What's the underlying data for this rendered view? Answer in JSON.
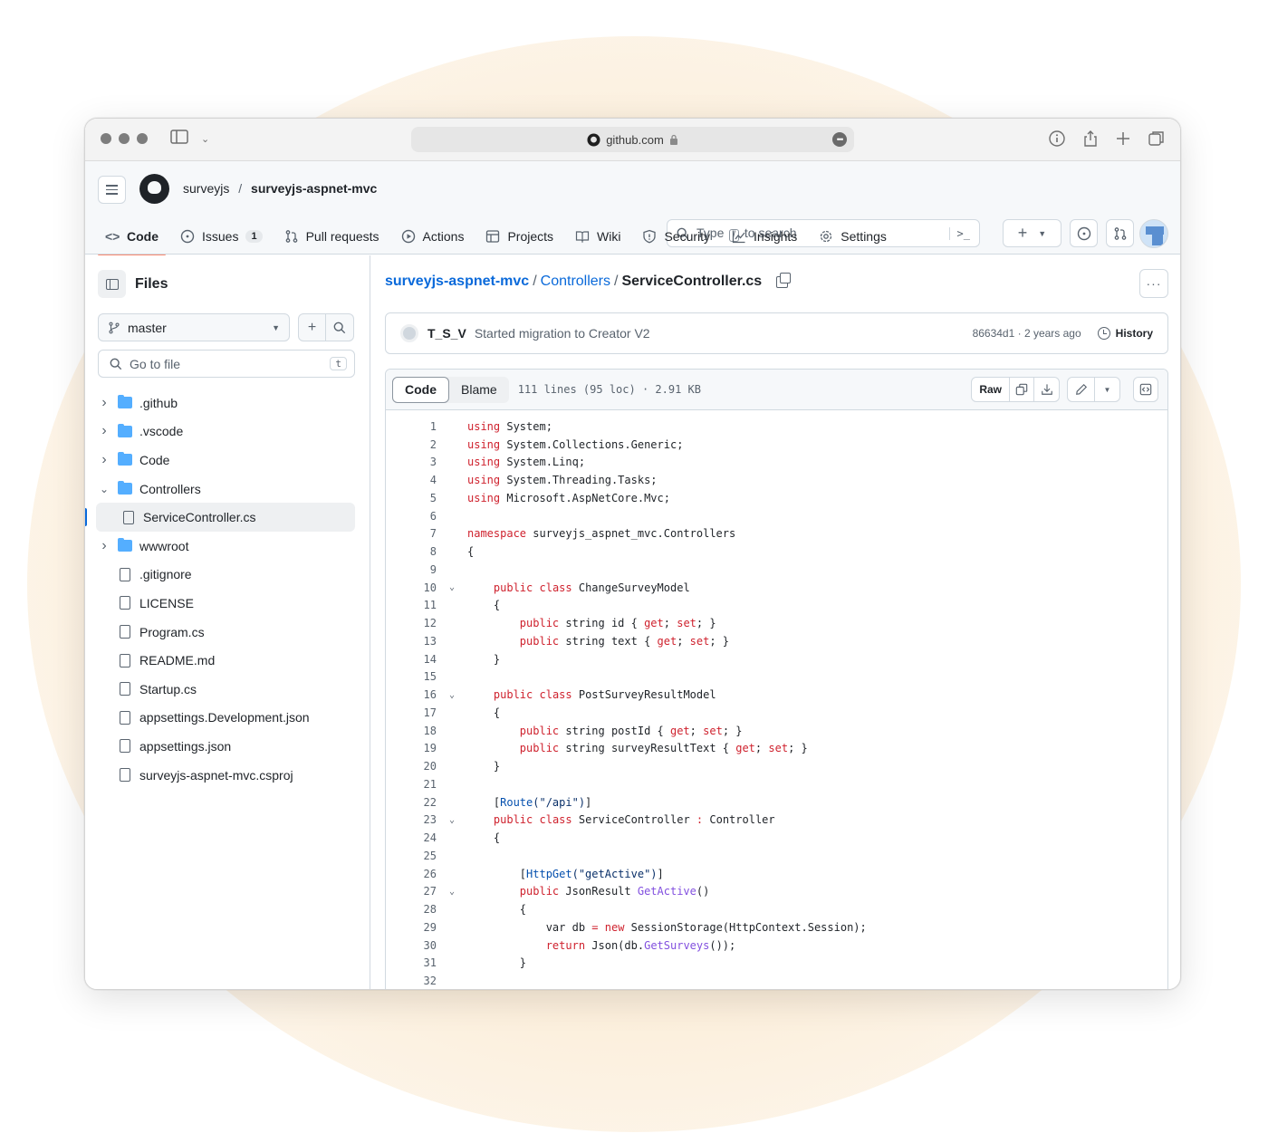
{
  "browser": {
    "url": "github.com"
  },
  "header": {
    "owner": "surveyjs",
    "separator": "/",
    "repo": "surveyjs-aspnet-mvc",
    "search_prefix": "Type",
    "search_key": "/",
    "search_suffix": "to search"
  },
  "tabs": [
    {
      "label": "Code",
      "icon": "code-icon"
    },
    {
      "label": "Issues",
      "icon": "issue-icon",
      "count": "1"
    },
    {
      "label": "Pull requests",
      "icon": "pull-request-icon"
    },
    {
      "label": "Actions",
      "icon": "play-icon"
    },
    {
      "label": "Projects",
      "icon": "table-icon"
    },
    {
      "label": "Wiki",
      "icon": "book-icon"
    },
    {
      "label": "Security",
      "icon": "shield-icon"
    },
    {
      "label": "Insights",
      "icon": "graph-icon"
    },
    {
      "label": "Settings",
      "icon": "gear-icon"
    }
  ],
  "sidebar": {
    "title": "Files",
    "branch": "master",
    "goto_placeholder": "Go to file",
    "goto_key": "t",
    "items": [
      {
        "label": ".github",
        "type": "folder",
        "expanded": false
      },
      {
        "label": ".vscode",
        "type": "folder",
        "expanded": false
      },
      {
        "label": "Code",
        "type": "folder",
        "expanded": false
      },
      {
        "label": "Controllers",
        "type": "folder",
        "expanded": true
      },
      {
        "label": "ServiceController.cs",
        "type": "file",
        "nested": true,
        "selected": true
      },
      {
        "label": "wwwroot",
        "type": "folder",
        "expanded": false
      },
      {
        "label": ".gitignore",
        "type": "file"
      },
      {
        "label": "LICENSE",
        "type": "file"
      },
      {
        "label": "Program.cs",
        "type": "file"
      },
      {
        "label": "README.md",
        "type": "file"
      },
      {
        "label": "Startup.cs",
        "type": "file"
      },
      {
        "label": "appsettings.Development.json",
        "type": "file"
      },
      {
        "label": "appsettings.json",
        "type": "file"
      },
      {
        "label": "surveyjs-aspnet-mvc.csproj",
        "type": "file"
      }
    ]
  },
  "breadcrumb": {
    "repo": "surveyjs-aspnet-mvc",
    "dir": "Controllers",
    "file": "ServiceController.cs",
    "sep": "/"
  },
  "commit": {
    "author": "T_S_V",
    "message": "Started migration to Creator V2",
    "sha_time": "86634d1 · 2 years ago",
    "history_label": "History"
  },
  "file_view": {
    "code_tab": "Code",
    "blame_tab": "Blame",
    "meta": "111 lines (95 loc) · 2.91 KB",
    "raw_label": "Raw"
  },
  "code": [
    {
      "n": "1",
      "t": [
        [
          "kw",
          "using"
        ],
        [
          "",
          " System;"
        ]
      ]
    },
    {
      "n": "2",
      "t": [
        [
          "kw",
          "using"
        ],
        [
          "",
          " System.Collections.Generic;"
        ]
      ]
    },
    {
      "n": "3",
      "t": [
        [
          "kw",
          "using"
        ],
        [
          "",
          " System.Linq;"
        ]
      ]
    },
    {
      "n": "4",
      "t": [
        [
          "kw",
          "using"
        ],
        [
          "",
          " System.Threading.Tasks;"
        ]
      ]
    },
    {
      "n": "5",
      "t": [
        [
          "kw",
          "using"
        ],
        [
          "",
          " Microsoft.AspNetCore.Mvc;"
        ]
      ]
    },
    {
      "n": "6",
      "t": []
    },
    {
      "n": "7",
      "t": [
        [
          "kw",
          "namespace"
        ],
        [
          "",
          " surveyjs_aspnet_mvc.Controllers"
        ]
      ]
    },
    {
      "n": "8",
      "t": [
        [
          "",
          "{"
        ]
      ]
    },
    {
      "n": "9",
      "t": []
    },
    {
      "n": "10",
      "fold": true,
      "t": [
        [
          "",
          "    "
        ],
        [
          "kw",
          "public"
        ],
        [
          "",
          " "
        ],
        [
          "kw",
          "class"
        ],
        [
          "",
          " ChangeSurveyModel"
        ]
      ]
    },
    {
      "n": "11",
      "t": [
        [
          "",
          "    {"
        ]
      ]
    },
    {
      "n": "12",
      "t": [
        [
          "",
          "        "
        ],
        [
          "kw",
          "public"
        ],
        [
          "",
          " string id { "
        ],
        [
          "kw",
          "get"
        ],
        [
          "",
          "; "
        ],
        [
          "kw",
          "set"
        ],
        [
          "",
          "; }"
        ]
      ]
    },
    {
      "n": "13",
      "t": [
        [
          "",
          "        "
        ],
        [
          "kw",
          "public"
        ],
        [
          "",
          " string text { "
        ],
        [
          "kw",
          "get"
        ],
        [
          "",
          "; "
        ],
        [
          "kw",
          "set"
        ],
        [
          "",
          "; }"
        ]
      ]
    },
    {
      "n": "14",
      "t": [
        [
          "",
          "    }"
        ]
      ]
    },
    {
      "n": "15",
      "t": []
    },
    {
      "n": "16",
      "fold": true,
      "t": [
        [
          "",
          "    "
        ],
        [
          "kw",
          "public"
        ],
        [
          "",
          " "
        ],
        [
          "kw",
          "class"
        ],
        [
          "",
          " PostSurveyResultModel"
        ]
      ]
    },
    {
      "n": "17",
      "t": [
        [
          "",
          "    {"
        ]
      ]
    },
    {
      "n": "18",
      "t": [
        [
          "",
          "        "
        ],
        [
          "kw",
          "public"
        ],
        [
          "",
          " string postId { "
        ],
        [
          "kw",
          "get"
        ],
        [
          "",
          "; "
        ],
        [
          "kw",
          "set"
        ],
        [
          "",
          "; }"
        ]
      ]
    },
    {
      "n": "19",
      "t": [
        [
          "",
          "        "
        ],
        [
          "kw",
          "public"
        ],
        [
          "",
          " string surveyResultText { "
        ],
        [
          "kw",
          "get"
        ],
        [
          "",
          "; "
        ],
        [
          "kw",
          "set"
        ],
        [
          "",
          "; }"
        ]
      ]
    },
    {
      "n": "20",
      "t": [
        [
          "",
          "    }"
        ]
      ]
    },
    {
      "n": "21",
      "t": []
    },
    {
      "n": "22",
      "t": [
        [
          "",
          "    ["
        ],
        [
          "attr",
          "Route"
        ],
        [
          "str",
          "(\"/api\")"
        ],
        [
          "",
          "]"
        ]
      ]
    },
    {
      "n": "23",
      "fold": true,
      "t": [
        [
          "",
          "    "
        ],
        [
          "kw",
          "public"
        ],
        [
          "",
          " "
        ],
        [
          "kw",
          "class"
        ],
        [
          "",
          " ServiceController "
        ],
        [
          "kw",
          ":"
        ],
        [
          "",
          " Controller"
        ]
      ]
    },
    {
      "n": "24",
      "t": [
        [
          "",
          "    {"
        ]
      ]
    },
    {
      "n": "25",
      "t": []
    },
    {
      "n": "26",
      "t": [
        [
          "",
          "        ["
        ],
        [
          "attr",
          "HttpGet"
        ],
        [
          "str",
          "(\"getActive\")"
        ],
        [
          "",
          "]"
        ]
      ]
    },
    {
      "n": "27",
      "fold": true,
      "t": [
        [
          "",
          "        "
        ],
        [
          "kw",
          "public"
        ],
        [
          "",
          " JsonResult "
        ],
        [
          "fn",
          "GetActive"
        ],
        [
          "",
          "()"
        ]
      ]
    },
    {
      "n": "28",
      "t": [
        [
          "",
          "        {"
        ]
      ]
    },
    {
      "n": "29",
      "t": [
        [
          "",
          "            var db "
        ],
        [
          "kw",
          "="
        ],
        [
          "",
          " "
        ],
        [
          "kw",
          "new"
        ],
        [
          "",
          " SessionStorage(HttpContext.Session);"
        ]
      ]
    },
    {
      "n": "30",
      "t": [
        [
          "",
          "            "
        ],
        [
          "kw",
          "return"
        ],
        [
          "",
          " Json(db."
        ],
        [
          "fn",
          "GetSurveys"
        ],
        [
          "",
          "());"
        ]
      ]
    },
    {
      "n": "31",
      "t": [
        [
          "",
          "        }"
        ]
      ]
    },
    {
      "n": "32",
      "t": []
    }
  ]
}
